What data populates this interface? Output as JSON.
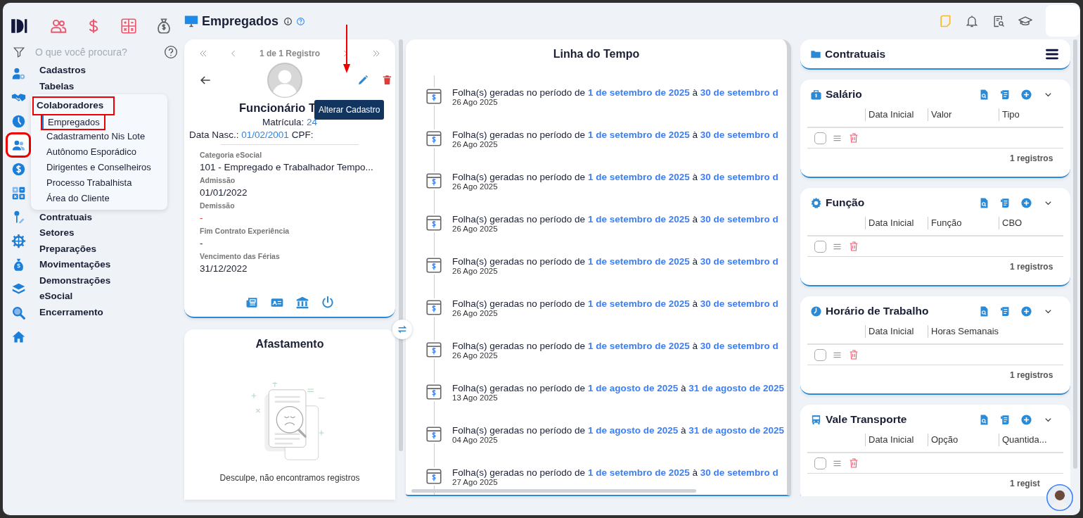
{
  "sidebar": {
    "modules": [
      {
        "kind": "people",
        "active": true
      },
      {
        "kind": "dollar",
        "active": true
      },
      {
        "kind": "calculator",
        "active": true
      },
      {
        "kind": "money-bag",
        "active": false
      }
    ],
    "search": {
      "placeholder": "O que você procura?"
    },
    "rail": [
      {
        "kind": "user-gear",
        "selected": false,
        "highlighted": false
      },
      {
        "kind": "handshake",
        "selected": false,
        "highlighted": false
      },
      {
        "kind": "clock",
        "selected": false,
        "highlighted": false
      },
      {
        "kind": "people",
        "selected": true,
        "highlighted": true
      },
      {
        "kind": "dollar-circle",
        "selected": false,
        "highlighted": false
      },
      {
        "kind": "calculator",
        "selected": false,
        "highlighted": false
      },
      {
        "kind": "pen",
        "selected": false,
        "highlighted": false
      },
      {
        "kind": "network-gear",
        "selected": false,
        "highlighted": false
      },
      {
        "kind": "money-bag",
        "selected": false,
        "highlighted": false
      },
      {
        "kind": "layers",
        "selected": false,
        "highlighted": false
      },
      {
        "kind": "search",
        "selected": false,
        "highlighted": false
      },
      {
        "kind": "home",
        "selected": false,
        "highlighted": false
      }
    ],
    "menu": [
      {
        "label": "Cadastros",
        "expanded": false,
        "highlighted": false
      },
      {
        "label": "Tabelas",
        "expanded": false,
        "highlighted": false
      },
      {
        "label": "Colaboradores",
        "expanded": true,
        "highlighted": true,
        "children": [
          {
            "label": "Empregados",
            "selected": true,
            "highlighted": true
          },
          {
            "label": "Cadastramento Nis Lote",
            "selected": false,
            "highlighted": false
          },
          {
            "label": "Autônomo Esporádico",
            "selected": false,
            "highlighted": false
          },
          {
            "label": "Dirigentes e Conselheiros",
            "selected": false,
            "highlighted": false
          },
          {
            "label": "Processo Trabalhista",
            "selected": false,
            "highlighted": false
          },
          {
            "label": "Área do Cliente",
            "selected": false,
            "highlighted": false
          }
        ]
      },
      {
        "label": "Contratuais",
        "expanded": false,
        "highlighted": false
      },
      {
        "label": "Setores",
        "expanded": false,
        "highlighted": false
      },
      {
        "label": "Preparações",
        "expanded": false,
        "highlighted": false
      },
      {
        "label": "Movimentações",
        "expanded": false,
        "highlighted": false
      },
      {
        "label": "Demonstrações",
        "expanded": false,
        "highlighted": false
      },
      {
        "label": "eSocial",
        "expanded": false,
        "highlighted": false
      },
      {
        "label": "Encerramento",
        "expanded": false,
        "highlighted": false
      }
    ]
  },
  "header": {
    "title": "Empregados"
  },
  "employee": {
    "pager": "1 de 1 Registro",
    "name": "Funcionário T",
    "tooltip": "Alterar Cadastro",
    "edit_annotated": true,
    "registration_label": "Matrícula:",
    "registration": "24",
    "birth_label": "Data Nasc.:",
    "birth": "01/02/2001",
    "cpf_label": "CPF:",
    "fields": [
      {
        "label": "Categoria eSocial",
        "value": "101 - Empregado e Trabalhador Tempo...",
        "alert": false
      },
      {
        "label": "Admissão",
        "value": "01/01/2022",
        "alert": false
      },
      {
        "label": "Demissão",
        "value": "-",
        "alert": true
      },
      {
        "label": "Fim Contrato Experiência",
        "value": "-",
        "alert": false
      },
      {
        "label": "Vencimento das Férias",
        "value": "31/12/2022",
        "alert": false
      }
    ]
  },
  "absence": {
    "title": "Afastamento",
    "empty_message": "Desculpe, não encontramos registros"
  },
  "timeline": {
    "title": "Linha do Tempo",
    "items": [
      {
        "text": "Folha(s) geradas no período de **1 de setembro de 2025** à **30 de setembro d**",
        "date": "26 Ago 2025"
      },
      {
        "text": "Folha(s) geradas no período de **1 de setembro de 2025** à **30 de setembro d**",
        "date": "26 Ago 2025"
      },
      {
        "text": "Folha(s) geradas no período de **1 de setembro de 2025** à **30 de setembro d**",
        "date": "26 Ago 2025"
      },
      {
        "text": "Folha(s) geradas no período de **1 de setembro de 2025** à **30 de setembro d**",
        "date": "26 Ago 2025"
      },
      {
        "text": "Folha(s) geradas no período de **1 de setembro de 2025** à **30 de setembro d**",
        "date": "26 Ago 2025"
      },
      {
        "text": "Folha(s) geradas no período de **1 de setembro de 2025** à **30 de setembro d**",
        "date": "26 Ago 2025"
      },
      {
        "text": "Folha(s) geradas no período de **1 de setembro de 2025** à **30 de setembro d**",
        "date": "26 Ago 2025"
      },
      {
        "text": "Folha(s) geradas no período de **1 de agosto de 2025** à **31 de agosto de 2025**",
        "date": "13 Ago 2025"
      },
      {
        "text": "Folha(s) geradas no período de **1 de agosto de 2025** à **31 de agosto de 2025**",
        "date": "04 Ago 2025"
      },
      {
        "text": "Folha(s) geradas no período de **1 de setembro de 2025** à **30 de setembro d**",
        "date": "27 Ago 2025"
      }
    ]
  },
  "contracts": {
    "title": "Contratuais",
    "sections": [
      {
        "title": "Salário",
        "kind": "briefcase",
        "columns": [
          "Data Inicial",
          "Valor",
          "Tipo"
        ],
        "rows": [
          {
            "checked": false
          }
        ],
        "count": "1 registros"
      },
      {
        "title": "Função",
        "kind": "gear",
        "columns": [
          "Data Inicial",
          "Função",
          "CBO"
        ],
        "rows": [
          {
            "checked": false
          }
        ],
        "count": "1 registros"
      },
      {
        "title": "Horário de Trabalho",
        "kind": "clock",
        "columns": [
          "Data Inicial",
          "Horas Semanais"
        ],
        "rows": [
          {
            "checked": false
          }
        ],
        "count": "1 registros"
      },
      {
        "title": "Vale Transporte",
        "kind": "bus",
        "columns": [
          "Data Inicial",
          "Opção",
          "Quantida..."
        ],
        "rows": [
          {
            "checked": false
          }
        ],
        "count": "1 regist"
      }
    ]
  }
}
